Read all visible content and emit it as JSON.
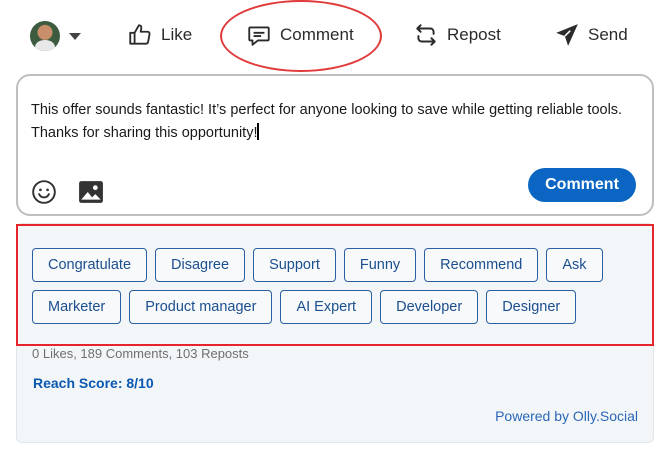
{
  "actions": {
    "like": "Like",
    "comment": "Comment",
    "repost": "Repost",
    "send": "Send"
  },
  "comment_box": {
    "text": "This offer sounds fantastic! It’s perfect for anyone looking to save while getting reliable tools. Thanks for sharing this opportunity!",
    "submit_label": "Comment"
  },
  "suggestions": {
    "row1": [
      "Congratulate",
      "Disagree",
      "Support",
      "Funny",
      "Recommend",
      "Ask"
    ],
    "row2": [
      "Marketer",
      "Product manager",
      "AI Expert",
      "Developer",
      "Designer"
    ]
  },
  "stats": "0 Likes, 189 Comments, 103 Reposts",
  "reach_score": "Reach Score: 8/10",
  "powered_by": "Powered by Olly.Social",
  "colors": {
    "accent": "#0a66c2",
    "highlight": "#e5252a",
    "chip_border": "#2a5fa0"
  },
  "icons": [
    "avatar",
    "chevron-down-icon",
    "thumbs-up-icon",
    "comment-icon",
    "repost-icon",
    "send-icon",
    "emoji-icon",
    "image-icon"
  ]
}
